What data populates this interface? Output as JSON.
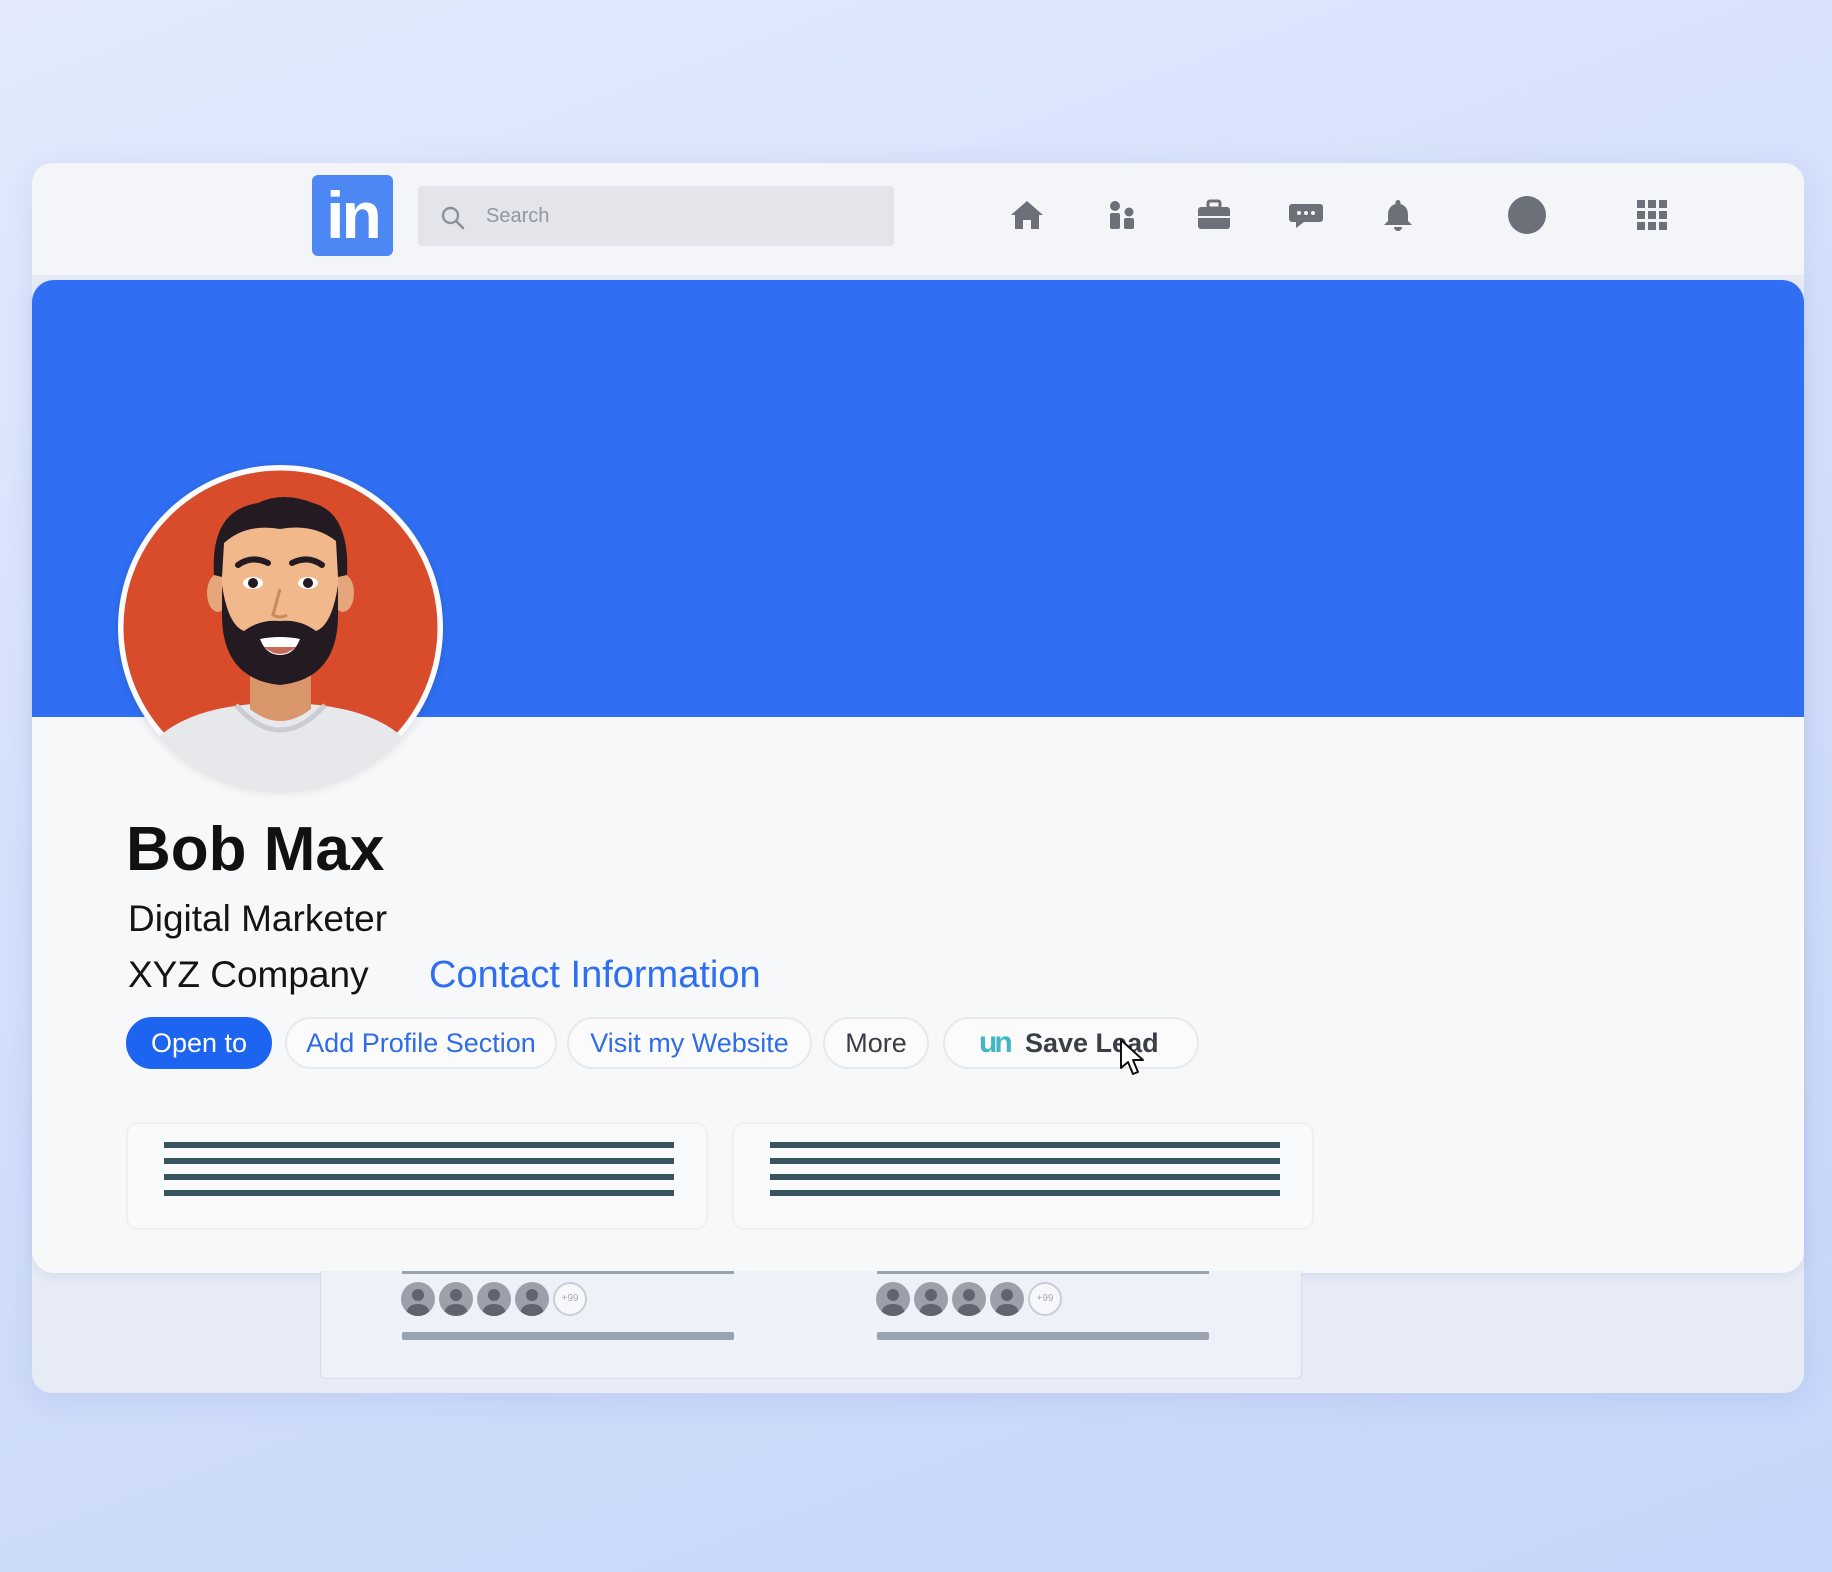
{
  "search": {
    "placeholder": "Search"
  },
  "logo": {
    "text": "in"
  },
  "nav_icons": [
    "home-icon",
    "my-network-icon",
    "jobs-icon",
    "messaging-icon",
    "notifications-icon",
    "me-avatar-icon",
    "apps-grid-icon"
  ],
  "profile": {
    "name": "Bob Max",
    "title": "Digital Marketer",
    "company": "XYZ Company",
    "contact_label": "Contact Information"
  },
  "actions": {
    "open_to": "Open to",
    "add_section": "Add Profile Section",
    "visit_website": "Visit my Website",
    "more": "More",
    "save_lead_logo": "un",
    "save_lead": "Save Lead"
  },
  "connections": {
    "overflow_label": "+99"
  },
  "colors": {
    "banner": "#306ff3",
    "primary": "#1d64f1",
    "link": "#2d6ff0",
    "logo": "#4d87f4",
    "avatar_bg": "#d84c2b",
    "save_lead_accent": "#43b6c4"
  }
}
